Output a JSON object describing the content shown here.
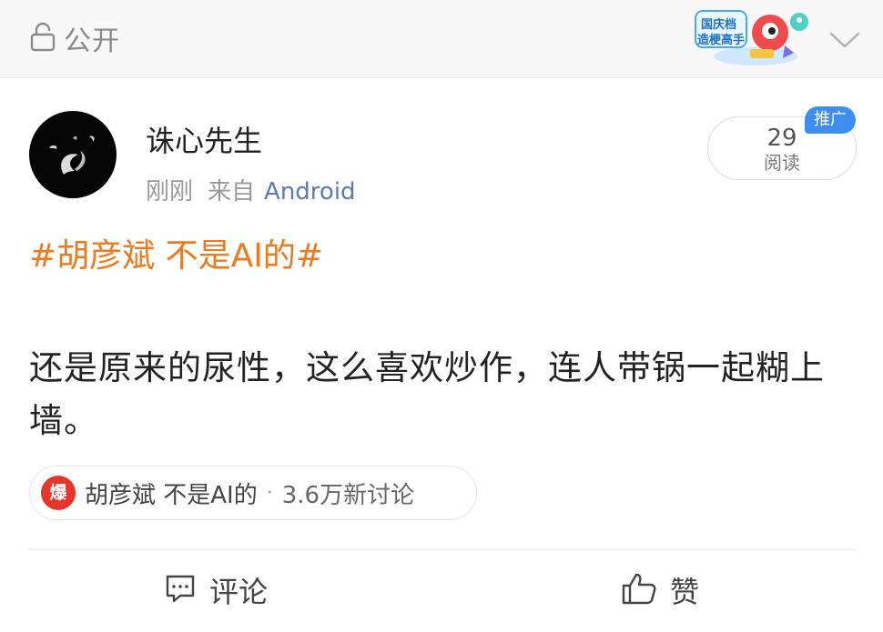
{
  "header": {
    "visibility_icon": "unlock-icon",
    "visibility_label": "公开",
    "mascot_badge": {
      "line1": "国庆档",
      "line2": "造梗高手"
    },
    "collapse_icon": "chevron-down-icon"
  },
  "post": {
    "author": "诛心先生",
    "time": "刚刚",
    "via_prefix": "来自",
    "source": "Android",
    "read_count": "29",
    "read_label": "阅读",
    "promo_badge": "推广",
    "topic": "#胡彦斌 不是AI的#",
    "body": "还是原来的尿性，这么喜欢炒作，连人带锅一起糊上墙。",
    "topic_chip": {
      "badge": "爆",
      "topic": "胡彦斌 不是AI的",
      "separator": "·",
      "discussion": "3.6万新讨论"
    }
  },
  "actions": {
    "comment_label": "评论",
    "like_label": "赞"
  },
  "colors": {
    "topic": "#eb7a20",
    "source_link": "#5a7bb0",
    "promo": "#3d8ef0",
    "hot_badge": "#e8352b"
  }
}
